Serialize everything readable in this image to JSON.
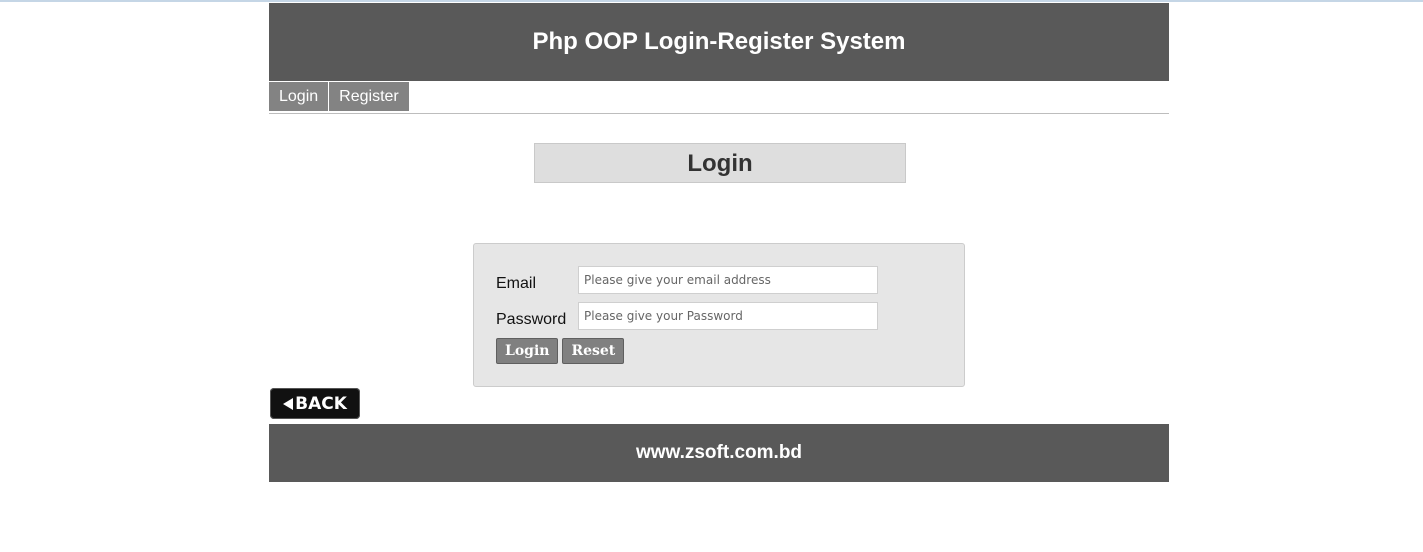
{
  "header": {
    "title": "Php OOP Login-Register System"
  },
  "nav": {
    "items": [
      {
        "label": "Login"
      },
      {
        "label": "Register"
      }
    ]
  },
  "page_title": "Login",
  "form": {
    "email_label": "Email",
    "email_placeholder": "Please give your email address",
    "email_value": "",
    "password_label": "Password",
    "password_placeholder": "Please give your Password",
    "password_value": "",
    "login_button": "Login",
    "reset_button": "Reset"
  },
  "back_button": {
    "label": "BACK",
    "icon": "left-triangle-icon"
  },
  "footer": {
    "text": "www.zsoft.com.bd"
  },
  "colors": {
    "header_bg": "#595959",
    "nav_bg": "#838383",
    "form_bg": "#e6e6e6",
    "title_bg": "#dedede"
  }
}
